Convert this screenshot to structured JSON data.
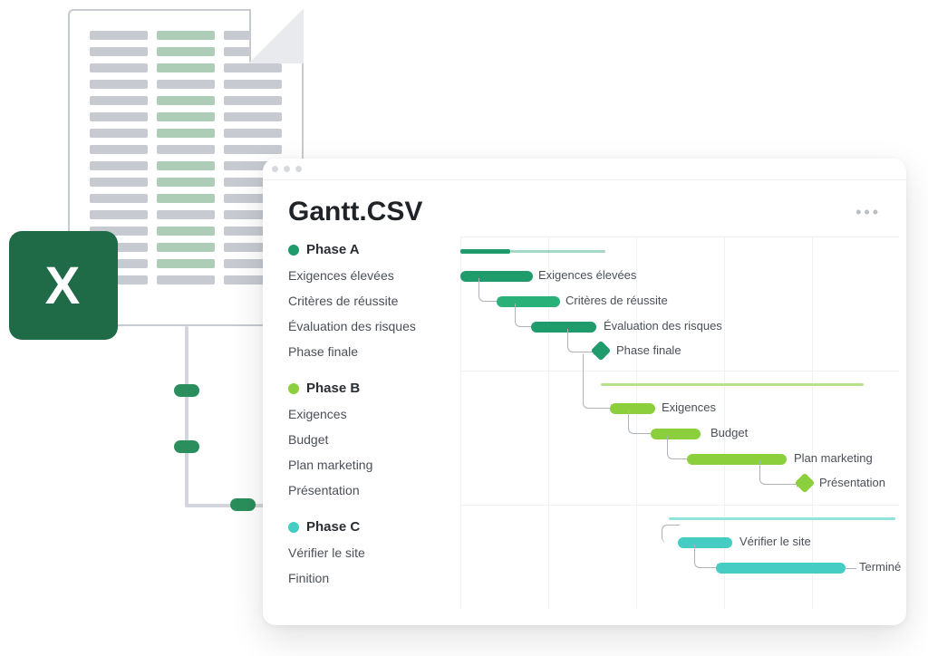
{
  "excel_badge": {
    "letter": "X"
  },
  "window": {
    "title": "Gantt.CSV",
    "more_menu_glyph": "•••"
  },
  "phases": [
    {
      "name": "Phase A",
      "color": "#1f9b6c",
      "tasks": [
        {
          "name": "Exigences élevées"
        },
        {
          "name": "Critères de réussite"
        },
        {
          "name": "Évaluation des risques"
        },
        {
          "name": "Phase finale"
        }
      ]
    },
    {
      "name": "Phase B",
      "color": "#8ccf3c",
      "tasks": [
        {
          "name": "Exigences"
        },
        {
          "name": "Budget"
        },
        {
          "name": "Plan marketing"
        },
        {
          "name": "Présentation"
        }
      ]
    },
    {
      "name": "Phase C",
      "color": "#45cdc3",
      "tasks": [
        {
          "name": "Vérifier le site"
        },
        {
          "name": "Finition"
        }
      ]
    }
  ],
  "chart_data": {
    "type": "gantt",
    "title": "Gantt.CSV",
    "time_unit": "generic",
    "x_range": [
      0,
      480
    ],
    "phases": [
      {
        "name": "Phase A",
        "color": "#1f9b6c",
        "summary": {
          "start": 0,
          "end": 160
        },
        "tasks": [
          {
            "name": "Exigences élevées",
            "label": "Exigences élevées",
            "start": 0,
            "end": 80,
            "type": "bar"
          },
          {
            "name": "Critères de réussite",
            "label": "Critères de réussite",
            "start": 40,
            "end": 110,
            "type": "bar"
          },
          {
            "name": "Évaluation des risques",
            "label": "Évaluation des risques",
            "start": 78,
            "end": 150,
            "type": "bar"
          },
          {
            "name": "Phase finale",
            "label": "Phase finale",
            "at": 155,
            "type": "milestone"
          }
        ],
        "dependencies": [
          [
            0,
            1
          ],
          [
            1,
            2
          ],
          [
            2,
            3
          ]
        ]
      },
      {
        "name": "Phase B",
        "color": "#8ccf3c",
        "summary": {
          "start": 155,
          "end": 445
        },
        "tasks": [
          {
            "name": "Exigences",
            "label": "Exigences",
            "start": 165,
            "end": 215,
            "type": "bar"
          },
          {
            "name": "Budget",
            "label": "Budget",
            "start": 210,
            "end": 265,
            "type": "bar"
          },
          {
            "name": "Plan marketing",
            "label": "Plan marketing",
            "start": 250,
            "end": 360,
            "type": "bar"
          },
          {
            "name": "Présentation",
            "label": "Présentation",
            "at": 380,
            "type": "milestone"
          }
        ],
        "dependencies": [
          [
            -1,
            0
          ],
          [
            0,
            1
          ],
          [
            1,
            2
          ],
          [
            2,
            3
          ]
        ]
      },
      {
        "name": "Phase C",
        "color": "#45cdc3",
        "summary": {
          "start": 230,
          "end": 480
        },
        "tasks": [
          {
            "name": "Vérifier le site",
            "label": "Vérifier le site",
            "start": 240,
            "end": 300,
            "type": "bar"
          },
          {
            "name": "Finition",
            "label": "Terminé",
            "start": 282,
            "end": 425,
            "type": "bar"
          }
        ],
        "dependencies": [
          [
            0,
            1
          ]
        ]
      }
    ]
  }
}
